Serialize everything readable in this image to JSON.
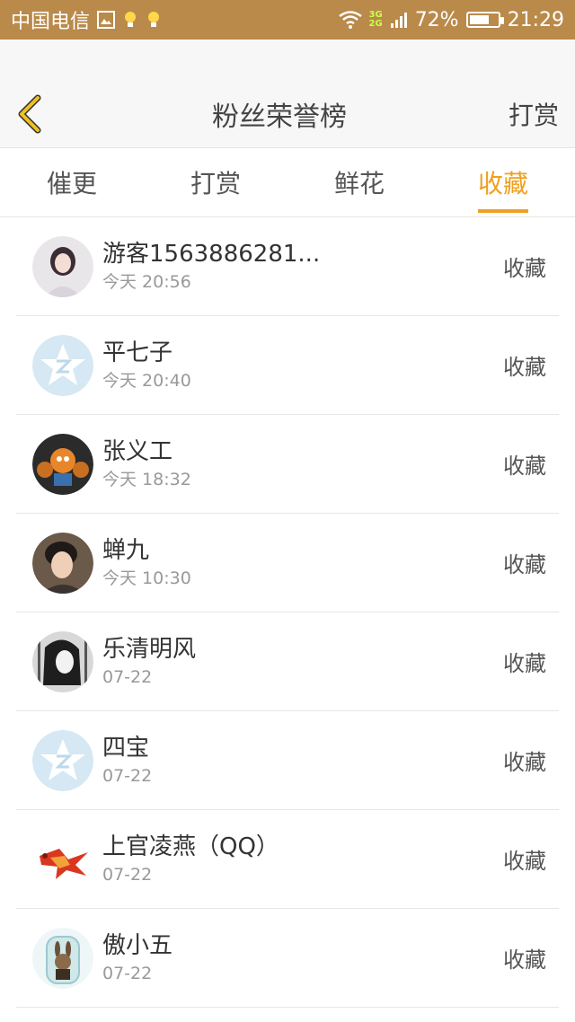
{
  "status_bar": {
    "carrier": "中国电信",
    "net_top": "3G",
    "net_bottom": "2G",
    "battery": "72%",
    "battery_level": 0.72,
    "time": "21:29"
  },
  "header": {
    "title": "粉丝荣誉榜",
    "right_label": "打赏"
  },
  "tabs": [
    {
      "label": "催更"
    },
    {
      "label": "打赏"
    },
    {
      "label": "鲜花"
    },
    {
      "label": "收藏",
      "active": true
    }
  ],
  "list": [
    {
      "name": "游客1563886281...",
      "time": "今天 20:56",
      "action": "收藏"
    },
    {
      "name": "平七子",
      "time": "今天 20:40",
      "action": "收藏"
    },
    {
      "name": "张义工",
      "time": "今天 18:32",
      "action": "收藏"
    },
    {
      "name": "蝉九",
      "time": "今天 10:30",
      "action": "收藏"
    },
    {
      "name": "乐清明风",
      "time": "07-22",
      "action": "收藏"
    },
    {
      "name": "四宝",
      "time": "07-22",
      "action": "收藏"
    },
    {
      "name": "上官凌燕（QQ）",
      "time": "07-22",
      "action": "收藏"
    },
    {
      "name": "傲小五",
      "time": "07-22",
      "action": "收藏"
    }
  ],
  "colors": {
    "status_bar_bg": "#b98a4a",
    "accent": "#f0a020",
    "back_icon": "#f0c020"
  }
}
